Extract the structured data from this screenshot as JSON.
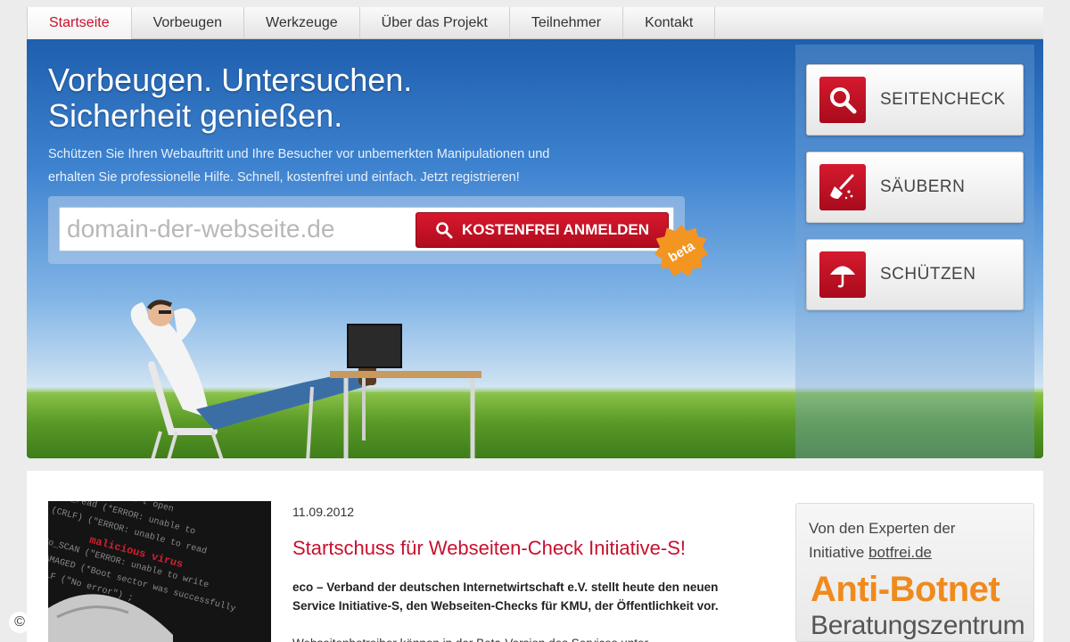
{
  "nav": {
    "items": [
      {
        "label": "Startseite",
        "active": true
      },
      {
        "label": "Vorbeugen",
        "active": false
      },
      {
        "label": "Werkzeuge",
        "active": false
      },
      {
        "label": "Über das Projekt",
        "active": false
      },
      {
        "label": "Teilnehmer",
        "active": false
      },
      {
        "label": "Kontakt",
        "active": false
      }
    ]
  },
  "hero": {
    "title_line1": "Vorbeugen. Untersuchen.",
    "title_line2": "Sicherheit genießen.",
    "text_line1": "Schützen Sie Ihren Webauftritt und Ihre Besucher vor unbemerkten Manipulationen und",
    "text_line2": "erhalten Sie professionelle Hilfe. Schnell, kostenfrei und einfach. Jetzt registrieren!",
    "signup": {
      "placeholder": "domain-der-webseite.de",
      "button_label": "KOSTENFREI ANMELDEN",
      "badge": "beta"
    }
  },
  "actions": [
    {
      "label": "SEITENCHECK",
      "icon": "magnifier-icon"
    },
    {
      "label": "SÄUBERN",
      "icon": "broom-icon"
    },
    {
      "label": "SCHÜTZEN",
      "icon": "umbrella-icon"
    }
  ],
  "news": {
    "date": "11.09.2012",
    "title": "Startschuss für Webseiten-Check Initiative-S!",
    "body": "eco – Verband der deutschen Internetwirtschaft e.V. stellt heute den neuen Service Initiative-S, den Webseiten-Checks für KMU, der Öffentlichkeit vor.",
    "more": "Webseitenbetreiber können in der Beta-Version des Services unter"
  },
  "sidebar": {
    "intro_line1": "Von den Experten der",
    "intro_line2_prefix": "Initiative ",
    "intro_link": "botfrei.de",
    "title": "Anti-Botnet",
    "subtitle": "Beratungszentrum"
  },
  "footer": {
    "copyright_symbol": "©"
  },
  "colors": {
    "brand_red": "#c8102e",
    "badge_orange": "#f39521",
    "botnet_orange": "#f08a1c"
  }
}
